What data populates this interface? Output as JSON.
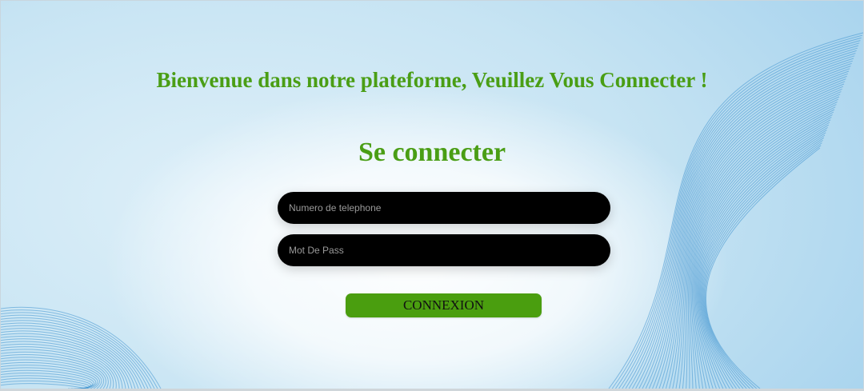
{
  "welcome_text": "Bienvenue dans notre plateforme, Veuillez Vous Connecter !",
  "login_title": "Se connecter",
  "form": {
    "phone_placeholder": "Numero de telephone",
    "password_placeholder": "Mot De Pass",
    "submit_label": "CONNEXION"
  },
  "colors": {
    "accent_green": "#4a9e15",
    "button_green": "#4a9e0f",
    "input_bg": "#000000",
    "background_blue": "#c7e4f3"
  }
}
